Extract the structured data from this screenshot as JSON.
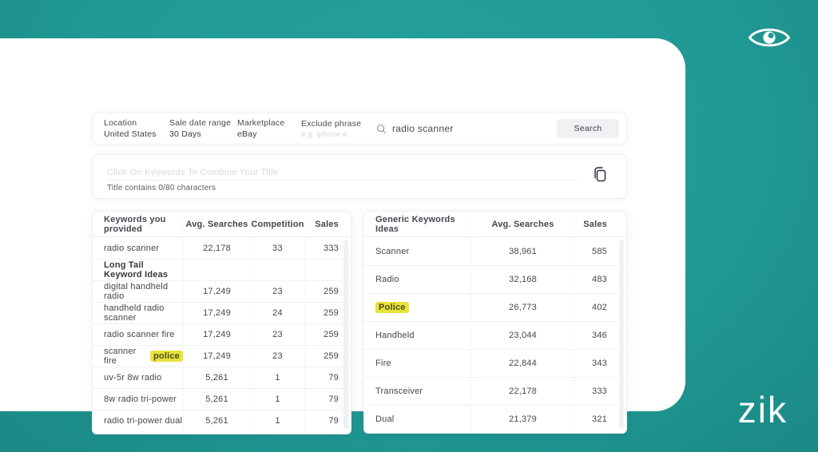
{
  "brand": {
    "logo_text": "zik",
    "eye_icon": "zik-eye-icon"
  },
  "colors": {
    "teal": "#219A95",
    "highlight": "#E7E33B",
    "card": "#FFFFFF"
  },
  "filter_bar": {
    "fields": [
      {
        "label": "Location",
        "value": "United States"
      },
      {
        "label": "Sale date range",
        "value": "30 Days"
      },
      {
        "label": "Marketplace",
        "value": "eBay"
      },
      {
        "label": "Exclude phrase",
        "placeholder": "e.g. iphone 4"
      }
    ],
    "search": {
      "icon": "search-icon",
      "value": "radio scanner"
    },
    "search_button_label": "Search"
  },
  "title_builder": {
    "placeholder": "Click On Keywords To Combine Your Title",
    "counter": "Title contains 0/80 characters",
    "copy_icon": "copy-icon"
  },
  "provided_table": {
    "headers": [
      "Keywords you provided",
      "Avg. Searches",
      "Competition",
      "Sales"
    ],
    "rows": [
      {
        "parts": [
          {
            "t": "radio scanner",
            "hl": false
          }
        ],
        "cells": [
          "22,178",
          "33",
          "333"
        ]
      },
      {
        "section": "Long Tail Keyword Ideas"
      },
      {
        "parts": [
          {
            "t": "digital handheld radio",
            "hl": false
          }
        ],
        "cells": [
          "17,249",
          "23",
          "259"
        ]
      },
      {
        "parts": [
          {
            "t": "handheld radio scanner",
            "hl": false
          }
        ],
        "cells": [
          "17,249",
          "24",
          "259"
        ]
      },
      {
        "parts": [
          {
            "t": "radio scanner fire",
            "hl": false
          }
        ],
        "cells": [
          "17,249",
          "23",
          "259"
        ]
      },
      {
        "parts": [
          {
            "t": "scanner fire ",
            "hl": false
          },
          {
            "t": "police",
            "hl": true
          }
        ],
        "cells": [
          "17,249",
          "23",
          "259"
        ]
      },
      {
        "parts": [
          {
            "t": "uv-5r 8w radio",
            "hl": false
          }
        ],
        "cells": [
          "5,261",
          "1",
          "79"
        ]
      },
      {
        "parts": [
          {
            "t": "8w radio tri-power",
            "hl": false
          }
        ],
        "cells": [
          "5,261",
          "1",
          "79"
        ]
      },
      {
        "parts": [
          {
            "t": "radio tri-power dual",
            "hl": false
          }
        ],
        "cells": [
          "5,261",
          "1",
          "79"
        ]
      }
    ]
  },
  "generic_table": {
    "headers": [
      "Generic Keywords Ideas",
      "Avg. Searches",
      "Sales"
    ],
    "rows": [
      {
        "parts": [
          {
            "t": "Scanner",
            "hl": false
          }
        ],
        "cells": [
          "38,961",
          "585"
        ]
      },
      {
        "parts": [
          {
            "t": "Radio",
            "hl": false
          }
        ],
        "cells": [
          "32,168",
          "483"
        ]
      },
      {
        "parts": [
          {
            "t": "Police",
            "hl": true
          }
        ],
        "cells": [
          "26,773",
          "402"
        ]
      },
      {
        "parts": [
          {
            "t": "Handheld",
            "hl": false
          }
        ],
        "cells": [
          "23,044",
          "346"
        ]
      },
      {
        "parts": [
          {
            "t": "Fire",
            "hl": false
          }
        ],
        "cells": [
          "22,844",
          "343"
        ]
      },
      {
        "parts": [
          {
            "t": "Transceiver",
            "hl": false
          }
        ],
        "cells": [
          "22,178",
          "333"
        ]
      },
      {
        "parts": [
          {
            "t": "Dual",
            "hl": false
          }
        ],
        "cells": [
          "21,379",
          "321"
        ]
      }
    ]
  }
}
